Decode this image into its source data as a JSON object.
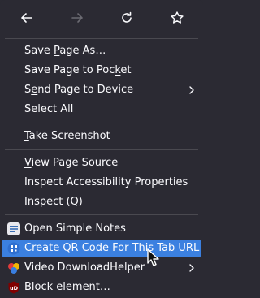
{
  "nav": {
    "back_icon": "arrow-left-icon",
    "forward_icon": "arrow-right-icon",
    "reload_icon": "reload-icon",
    "bookmark_icon": "star-icon"
  },
  "menu": {
    "save_page_as": {
      "pre": "Save ",
      "key": "P",
      "post": "age As…"
    },
    "save_to_pocket": {
      "pre": "Save Page to Poc",
      "key": "k",
      "post": "et"
    },
    "send_to_device": {
      "pre": "S",
      "key": "e",
      "post": "nd Page to Device"
    },
    "select_all": {
      "pre": "Select ",
      "key": "A",
      "post": "ll"
    },
    "take_screenshot": {
      "pre": "",
      "key": "T",
      "post": "ake Screenshot"
    },
    "view_source": {
      "pre": "",
      "key": "V",
      "post": "iew Page Source"
    },
    "inspect_accessibility": "Inspect Accessibility Properties",
    "inspect": "Inspect (Q)",
    "simple_notes": "Open Simple Notes",
    "qr_code": "Create QR Code For This Tab URL",
    "video_dl": "Video DownloadHelper",
    "block_element": "Block element…"
  },
  "colors": {
    "menu_bg": "#2b2a33",
    "text": "#fbfbfe",
    "highlight": "#3b80e0",
    "separator": "#4a4950"
  }
}
